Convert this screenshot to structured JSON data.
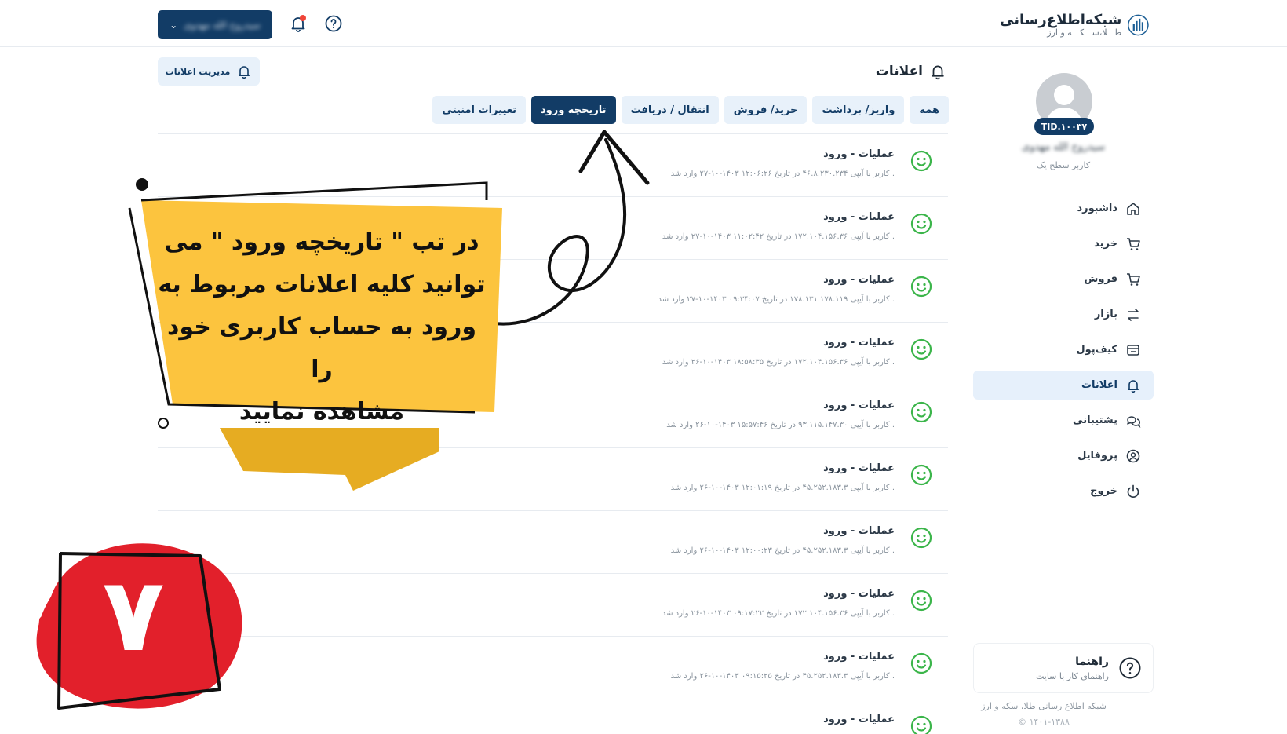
{
  "header": {
    "logo_title": "شبکه‌اطلاع‌رسانی",
    "logo_subtitle": "طـــلا،ســـکـــه و ارز",
    "user_button_label": "سیدروح الله مهدوی",
    "notification_icon": "bell-icon",
    "help_icon": "question-circle-icon"
  },
  "sidebar": {
    "tid": "TID.۱۰۰۳۷",
    "user_name": "سیدروح الله مهدوی",
    "user_level": "کاربر سطح یک",
    "items": [
      {
        "label": "داشبورد",
        "icon": "home-icon"
      },
      {
        "label": "خرید",
        "icon": "cart-icon"
      },
      {
        "label": "فروش",
        "icon": "cart-icon"
      },
      {
        "label": "بازار",
        "icon": "exchange-icon"
      },
      {
        "label": "کیف‌پول",
        "icon": "wallet-icon"
      },
      {
        "label": "اعلانات",
        "icon": "bell-icon"
      },
      {
        "label": "پشتیبانی",
        "icon": "chat-icon"
      },
      {
        "label": "پروفایل",
        "icon": "user-circle-icon"
      },
      {
        "label": "خروج",
        "icon": "power-icon"
      }
    ],
    "help_title": "راهنما",
    "help_subtitle": "راهنمای کار با سایت",
    "footer_name": "شبکه اطلاع رسانی طلا، سکه و ارز",
    "footer_copy": "© ۱۴۰۱-۱۳۸۸"
  },
  "main": {
    "title": "اعلانات",
    "manage_button": "مدیریت اعلانات",
    "tabs": [
      {
        "label": "همه"
      },
      {
        "label": "واریز/ برداشت"
      },
      {
        "label": "خرید/ فروش"
      },
      {
        "label": "انتقال / دریافت"
      },
      {
        "label": "تاریخچه ورود"
      },
      {
        "label": "تغییرات امنیتی"
      }
    ],
    "active_tab": "تاریخچه ورود",
    "notifications": [
      {
        "title": "عملیات - ورود",
        "desc": "کاربر با آیپی ۴۶.۸.۲۳۰.۲۳۴ در تاریخ ۱۲:۰۶:۲۶ ۱۴۰۳-۱۰-۲۷ وارد شد ."
      },
      {
        "title": "عملیات - ورود",
        "desc": "کاربر با آیپی ۱۷۲.۱۰۴.۱۵۶.۳۶ در تاریخ ۱۱:۰۲:۴۲ ۱۴۰۳-۱۰-۲۷ وارد شد ."
      },
      {
        "title": "عملیات - ورود",
        "desc": "کاربر با آیپی ۱۷۸.۱۳۱.۱۷۸.۱۱۹ در تاریخ ۰۹:۳۴:۰۷ ۱۴۰۳-۱۰-۲۷ وارد شد ."
      },
      {
        "title": "عملیات - ورود",
        "desc": "کاربر با آیپی ۱۷۲.۱۰۴.۱۵۶.۳۶ در تاریخ ۱۸:۵۸:۳۵ ۱۴۰۳-۱۰-۲۶ وارد شد ."
      },
      {
        "title": "عملیات - ورود",
        "desc": "کاربر با آیپی ۹۳.۱۱۵.۱۴۷.۳۰ در تاریخ ۱۵:۵۷:۴۶ ۱۴۰۳-۱۰-۲۶ وارد شد ."
      },
      {
        "title": "عملیات - ورود",
        "desc": "کاربر با آیپی ۴۵.۲۵۲.۱۸۳.۳ در تاریخ ۱۲:۰۱:۱۹ ۱۴۰۳-۱۰-۲۶ وارد شد ."
      },
      {
        "title": "عملیات - ورود",
        "desc": "کاربر با آیپی ۴۵.۲۵۲.۱۸۳.۳ در تاریخ ۱۲:۰۰:۲۳ ۱۴۰۳-۱۰-۲۶ وارد شد ."
      },
      {
        "title": "عملیات - ورود",
        "desc": "کاربر با آیپی ۱۷۲.۱۰۴.۱۵۶.۳۶ در تاریخ ۰۹:۱۷:۲۲ ۱۴۰۳-۱۰-۲۶ وارد شد ."
      },
      {
        "title": "عملیات - ورود",
        "desc": "کاربر با آیپی ۴۵.۲۵۲.۱۸۳.۳ در تاریخ ۰۹:۱۵:۲۵ ۱۴۰۳-۱۰-۲۶ وارد شد ."
      },
      {
        "title": "عملیات - ورود",
        "desc": ""
      }
    ]
  },
  "overlay": {
    "banner_line1": "در تب \" تاریخچه ورود \" می",
    "banner_line2": "توانید کلیه اعلانات مربوط به",
    "banner_line3": "ورود به حساب کاربری خود را",
    "banner_line4": "مشاهده نمایید",
    "step_number": "۷"
  },
  "colors": {
    "primary": "#123c66",
    "tab_bg": "#e8f1fa",
    "success": "#3bb54a",
    "banner_yellow": "#fcc43e",
    "badge_red": "#e2202b",
    "notification_dot": "#f04438"
  }
}
